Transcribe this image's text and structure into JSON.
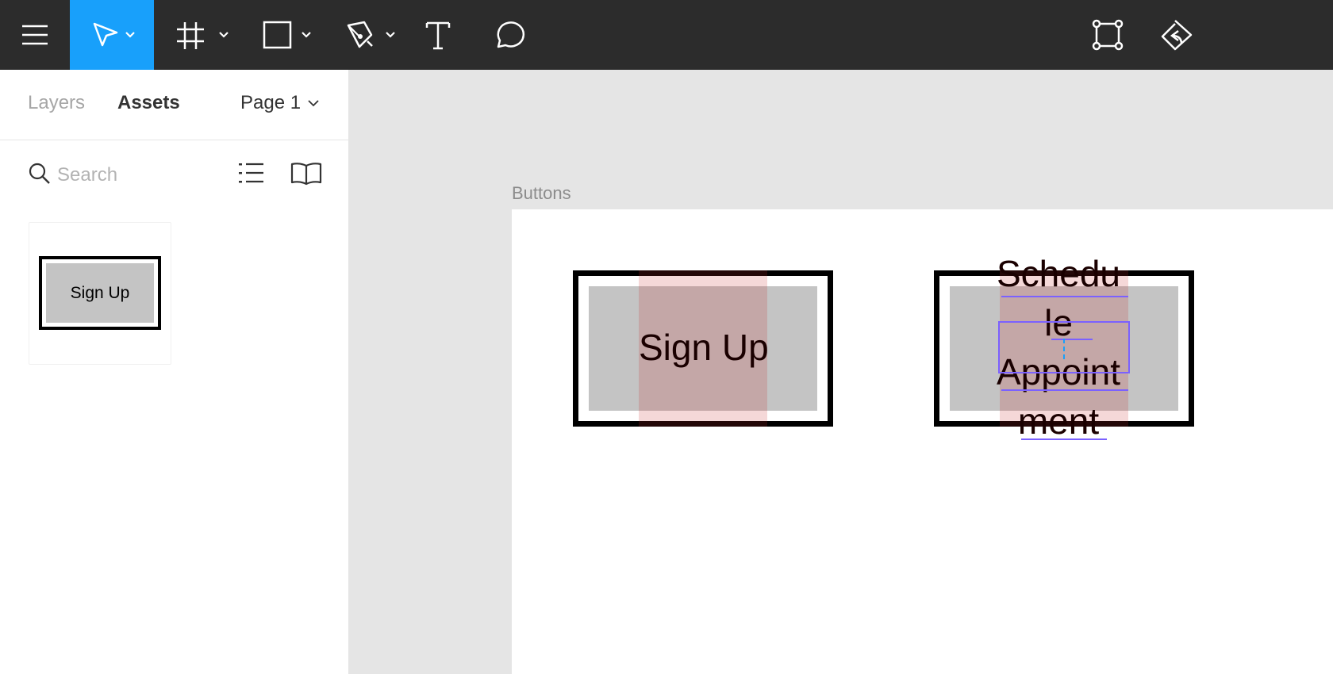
{
  "toolbar": {
    "icons": [
      "menu-icon",
      "move-icon",
      "frame-icon",
      "rectangle-icon",
      "pen-icon",
      "text-icon",
      "comment-icon",
      "component-icon",
      "share-icon"
    ],
    "accent": "#18a0fb"
  },
  "panel": {
    "tabs": {
      "layers": "Layers",
      "assets": "Assets"
    },
    "page": "Page 1",
    "search": {
      "placeholder": "Search",
      "value": ""
    },
    "asset": {
      "label": "Sign Up"
    }
  },
  "canvas": {
    "frame_label": "Buttons",
    "button1": {
      "label": "Sign Up"
    },
    "button2": {
      "lines": [
        "Schedu",
        "le",
        "Appoint",
        "ment"
      ]
    }
  }
}
